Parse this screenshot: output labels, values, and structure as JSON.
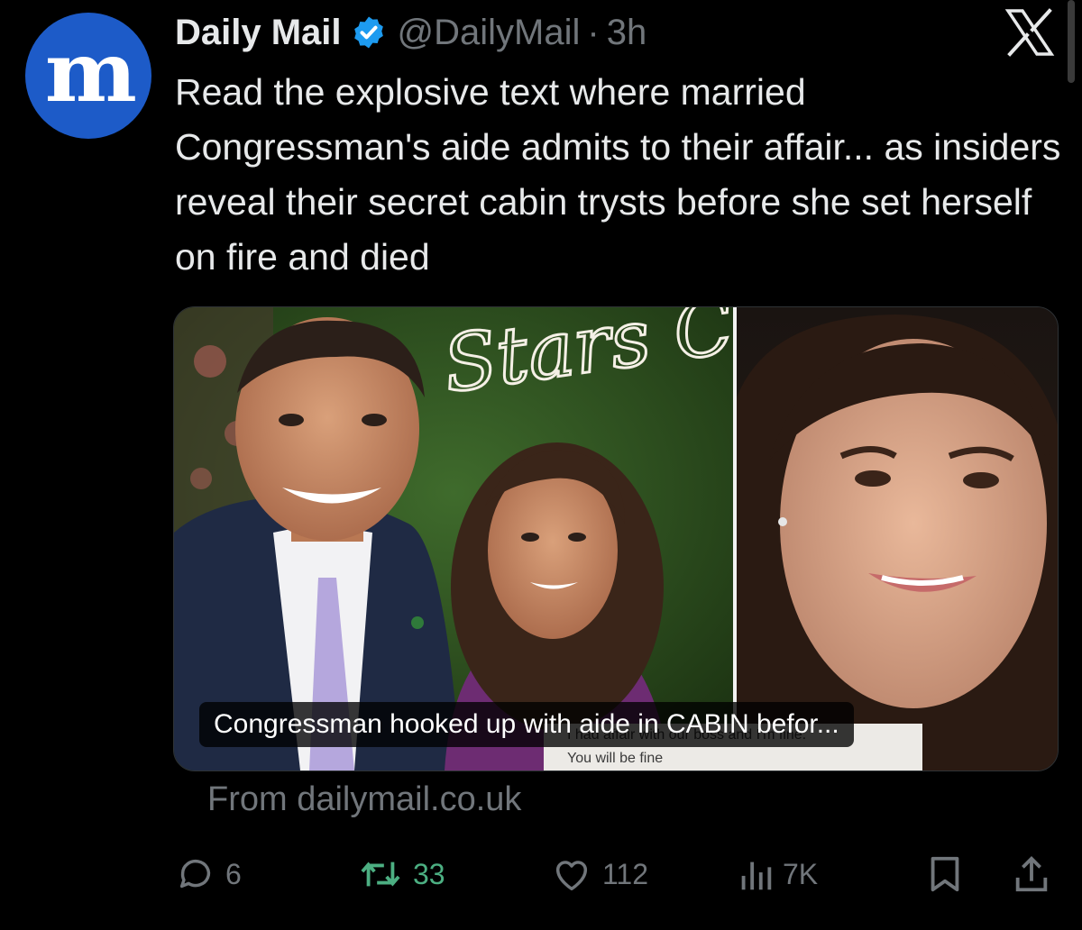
{
  "post": {
    "avatar_letter": "m",
    "display_name": "Daily Mail",
    "handle": "@DailyMail",
    "separator": "·",
    "time": "3h",
    "text": "Read the explosive text where married Congressman's aide admits to their affair... as insiders reveal their secret cabin trysts before she set herself on fire and died",
    "verified_color": "#1d9bf0"
  },
  "card": {
    "headline": "Congressman hooked up with aide in CABIN befor...",
    "overlay_line1": "I had affair with our boss and I'm fine.",
    "overlay_line2": "You will be fine",
    "neon_sign_text": "Stars C",
    "source": "From dailymail.co.uk"
  },
  "actions": {
    "replies": "6",
    "reposts": "33",
    "likes": "112",
    "views": "7K"
  },
  "icons": {
    "platform_logo": "x-logo-icon",
    "reply": "speech-bubble-icon",
    "repost": "repost-arrows-icon",
    "like": "heart-icon",
    "views": "bar-chart-icon",
    "bookmark": "bookmark-icon",
    "share": "share-upload-icon"
  },
  "colors": {
    "background": "#000000",
    "primary_text": "#e7e9ea",
    "secondary_text": "#71767b",
    "repost_active": "#4caf82",
    "avatar_bg": "#1d5bc8"
  }
}
